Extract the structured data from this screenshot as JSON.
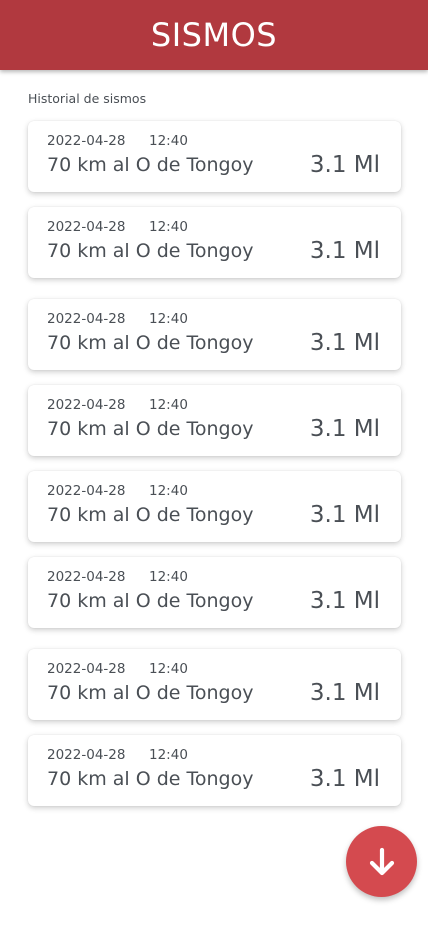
{
  "header": {
    "title": "SISMOS"
  },
  "section": {
    "label": "Historial de sismos"
  },
  "events": [
    {
      "date": "2022-04-28",
      "time": "12:40",
      "place": "70 km al O de Tongoy",
      "magnitude": "3.1 Ml"
    },
    {
      "date": "2022-04-28",
      "time": "12:40",
      "place": "70 km al O de Tongoy",
      "magnitude": "3.1 Ml"
    },
    {
      "date": "2022-04-28",
      "time": "12:40",
      "place": "70 km al O de Tongoy",
      "magnitude": "3.1 Ml"
    },
    {
      "date": "2022-04-28",
      "time": "12:40",
      "place": "70 km al O de Tongoy",
      "magnitude": "3.1 Ml"
    },
    {
      "date": "2022-04-28",
      "time": "12:40",
      "place": "70 km al O de Tongoy",
      "magnitude": "3.1 Ml"
    },
    {
      "date": "2022-04-28",
      "time": "12:40",
      "place": "70 km al O de Tongoy",
      "magnitude": "3.1 Ml"
    },
    {
      "date": "2022-04-28",
      "time": "12:40",
      "place": "70 km al O de Tongoy",
      "magnitude": "3.1 Ml"
    },
    {
      "date": "2022-04-28",
      "time": "12:40",
      "place": "70 km al O de Tongoy",
      "magnitude": "3.1 Ml"
    }
  ],
  "fab": {
    "icon": "arrow-down-icon"
  },
  "colors": {
    "header": "#b1393f",
    "fab": "#d44a4f",
    "text": "#4a4f55",
    "background": "#ffffff"
  }
}
